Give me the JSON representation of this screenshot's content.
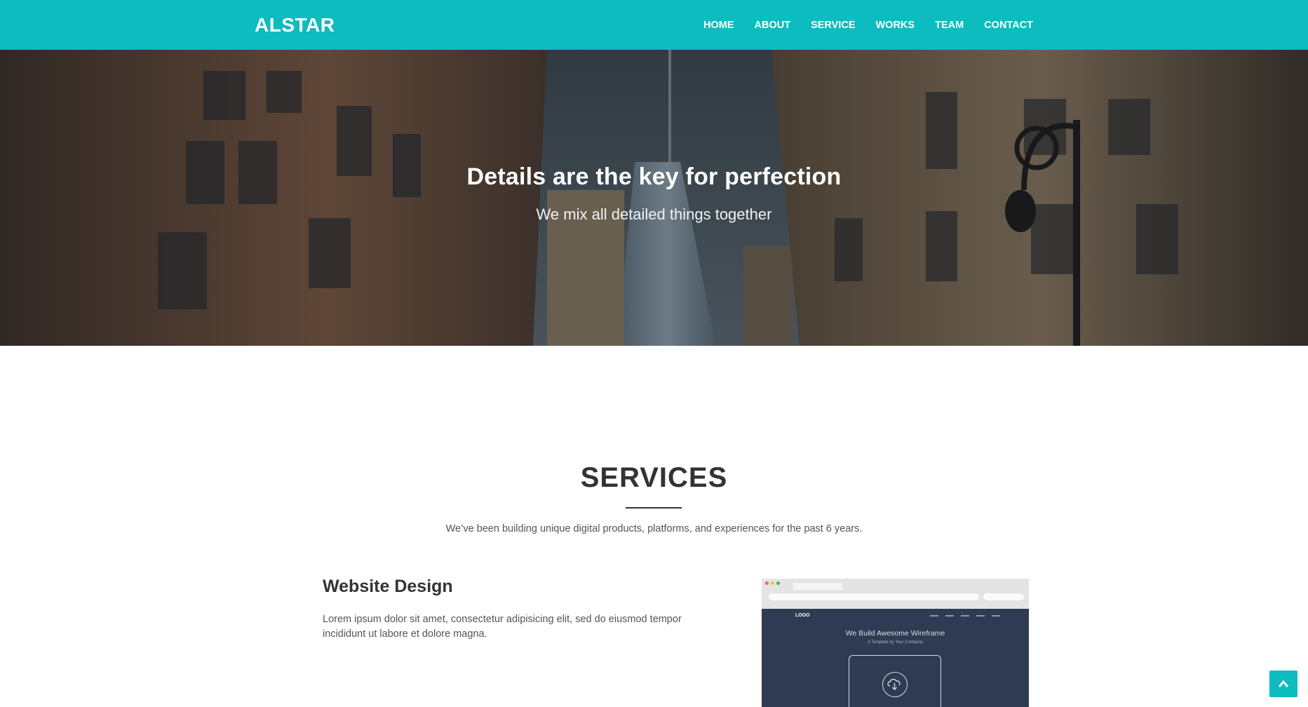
{
  "colors": {
    "accent": "#0cbcbf",
    "heading": "#333333",
    "text": "#555555",
    "mockup_bg": "#2f3b52"
  },
  "nav": {
    "brand": "ALSTAR",
    "items": [
      {
        "label": "HOME"
      },
      {
        "label": "ABOUT"
      },
      {
        "label": "SERVICE"
      },
      {
        "label": "WORKS"
      },
      {
        "label": "TEAM"
      },
      {
        "label": "CONTACT"
      }
    ]
  },
  "hero": {
    "title": "Details are the key for perfection",
    "subtitle": "We mix all detailed things together",
    "background_image": "city-buildings-photo"
  },
  "services": {
    "title": "SERVICES",
    "description": "We’ve been building unique digital products, platforms, and experiences for the past 6 years.",
    "items": [
      {
        "title": "Website Design",
        "text": "Lorem ipsum dolor sit amet, consectetur adipisicing elit, sed do eiusmod tempor incididunt ut labore et dolore magna.",
        "image": {
          "logo": "LOGO",
          "headline": "We Build Awesome Wireframe",
          "tagline": "A Template by Your Company",
          "icon": "cloud-download-icon"
        }
      }
    ]
  },
  "back_to_top": {
    "icon": "chevron-up-icon"
  }
}
